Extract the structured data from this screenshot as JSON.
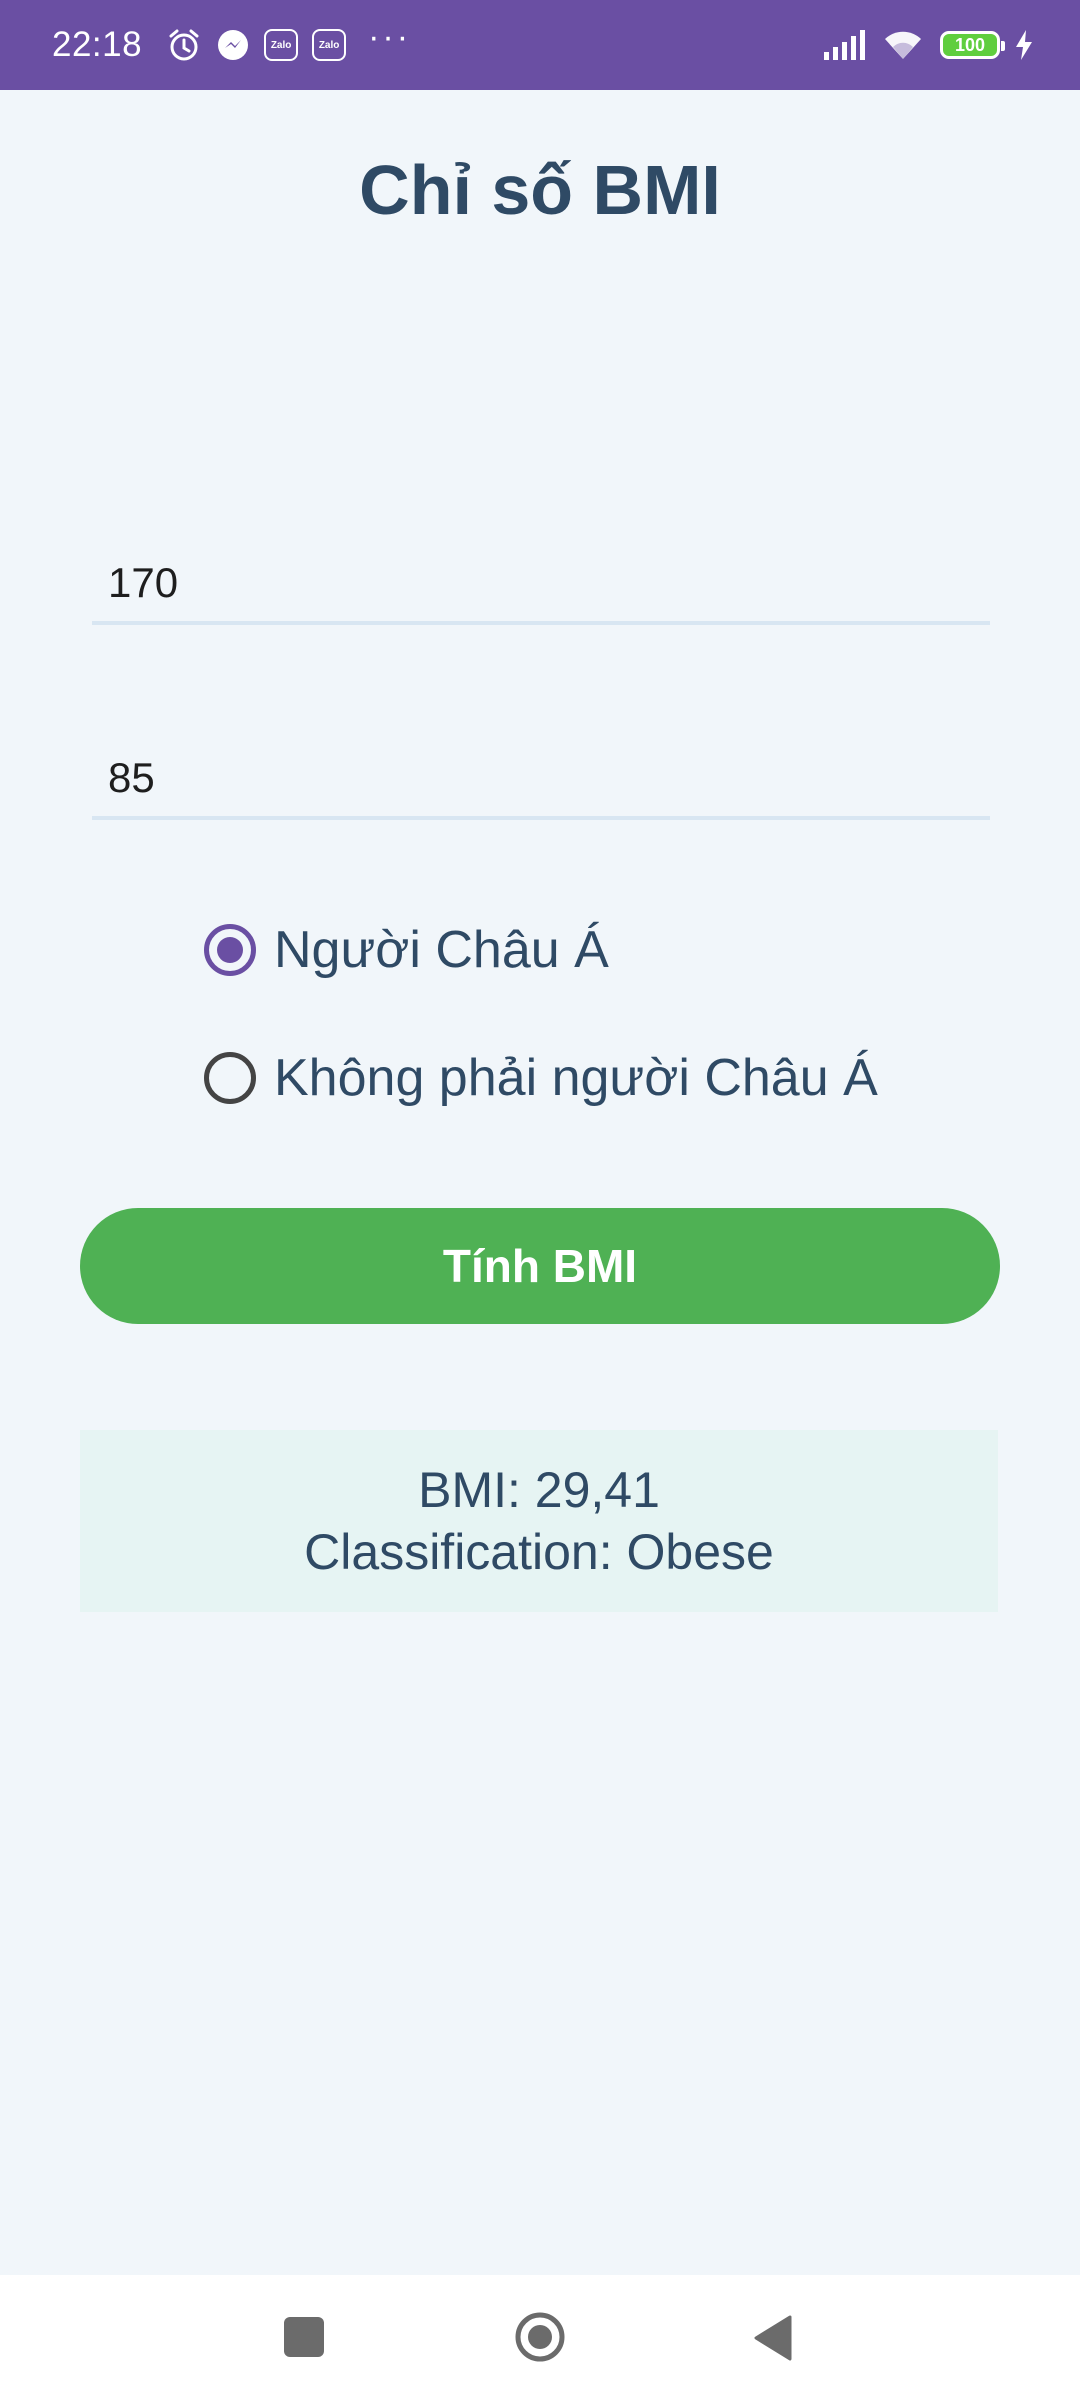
{
  "status_bar": {
    "time": "22:18",
    "zalo_label": "Zalo",
    "dots": "···",
    "battery_level": "100",
    "icons": [
      "alarm-icon",
      "messenger-icon",
      "zalo-icon",
      "zalo-icon",
      "more-icon",
      "signal-icon",
      "wifi-icon",
      "battery-icon",
      "charging-icon"
    ],
    "bar_color": "#6a4fa3"
  },
  "page": {
    "title": "Chỉ số BMI"
  },
  "form": {
    "height_value": "170",
    "weight_value": "85",
    "options": [
      {
        "label": "Người Châu Á",
        "selected": true
      },
      {
        "label": "Không phải người Châu Á",
        "selected": false
      }
    ],
    "button_label": "Tính BMI",
    "button_color": "#4fb154"
  },
  "result": {
    "bmi_line": "BMI: 29,41",
    "classification_line": "Classification: Obese"
  },
  "nav_bar": {
    "icons": [
      "recents-icon",
      "home-icon",
      "back-icon"
    ]
  }
}
